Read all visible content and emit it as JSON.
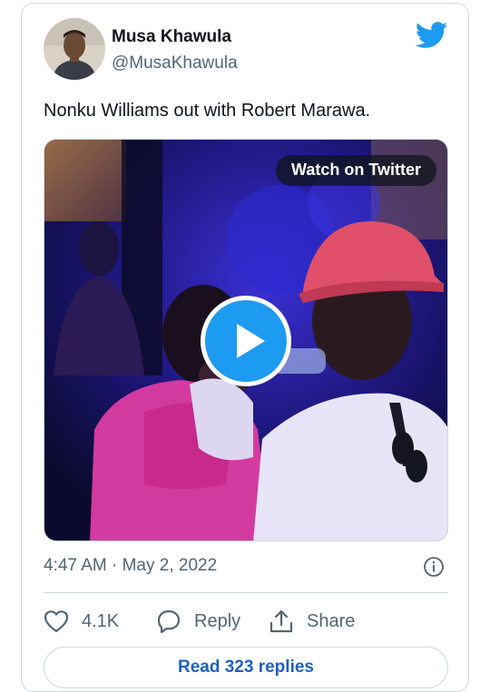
{
  "author": {
    "display_name": "Musa Khawula",
    "handle": "@MusaKhawula"
  },
  "tweet": {
    "text": "Nonku Williams out with Robert Marawa.",
    "timestamp": "4:47 AM · May 2, 2022"
  },
  "media": {
    "watch_label": "Watch on Twitter"
  },
  "actions": {
    "like_count": "4.1K",
    "reply_label": "Reply",
    "share_label": "Share"
  },
  "read_replies_label": "Read 323 replies",
  "colors": {
    "twitter_blue": "#1d9bf0",
    "link_blue": "#1d5fc0",
    "secondary_text": "#536471",
    "border": "#cfd9de"
  },
  "icons": [
    "twitter-bird-icon",
    "play-icon",
    "info-icon",
    "heart-icon",
    "reply-bubble-icon",
    "share-icon"
  ]
}
